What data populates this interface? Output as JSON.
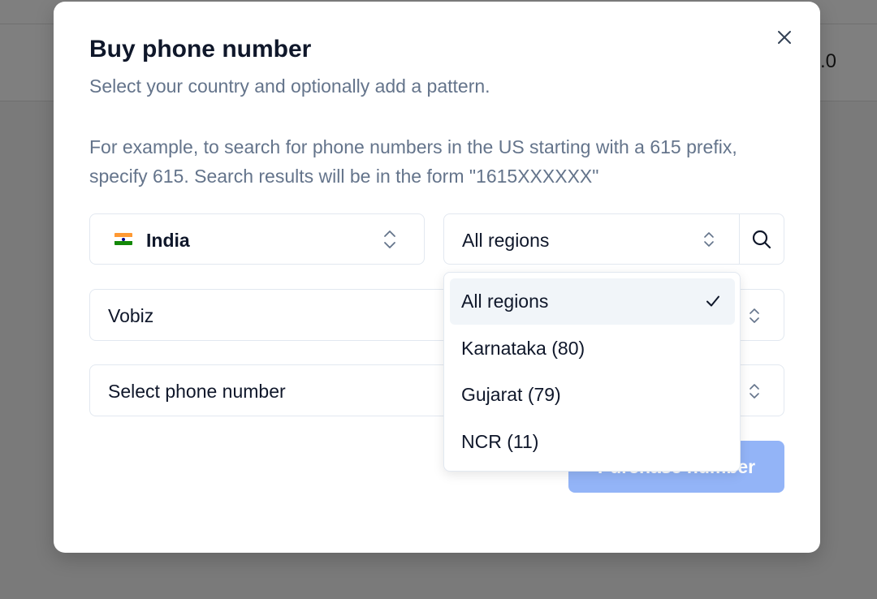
{
  "background": {
    "version_text": ".0"
  },
  "dialog": {
    "title": "Buy phone number",
    "subtitle": "Select your country and optionally add a pattern.",
    "description": "For example, to search for phone numbers in the US starting with a 615 prefix, specify 615. Search results will be in the form \"1615XXXXXX\"",
    "close_icon": "close-icon",
    "country": {
      "value": "India",
      "flag": "india-flag-icon",
      "flag_colors": [
        "#ff9933",
        "#ffffff",
        "#138808"
      ]
    },
    "region": {
      "value": "All regions",
      "options": [
        {
          "label": "All regions",
          "selected": true
        },
        {
          "label": "Karnataka (80)",
          "selected": false
        },
        {
          "label": "Gujarat (79)",
          "selected": false
        },
        {
          "label": "NCR (11)",
          "selected": false
        }
      ]
    },
    "search_icon": "search-icon",
    "provider": {
      "value": "Vobiz"
    },
    "phone_number": {
      "placeholder": "Select phone number"
    },
    "purchase_button": {
      "label": "Purchase number",
      "color": "#93b4f7"
    }
  },
  "colors": {
    "overlay": "#7a7a7a",
    "text_primary": "#0f172a",
    "text_muted": "#64748b",
    "border": "#e2e8f0",
    "selected_bg": "#f1f5f9"
  }
}
